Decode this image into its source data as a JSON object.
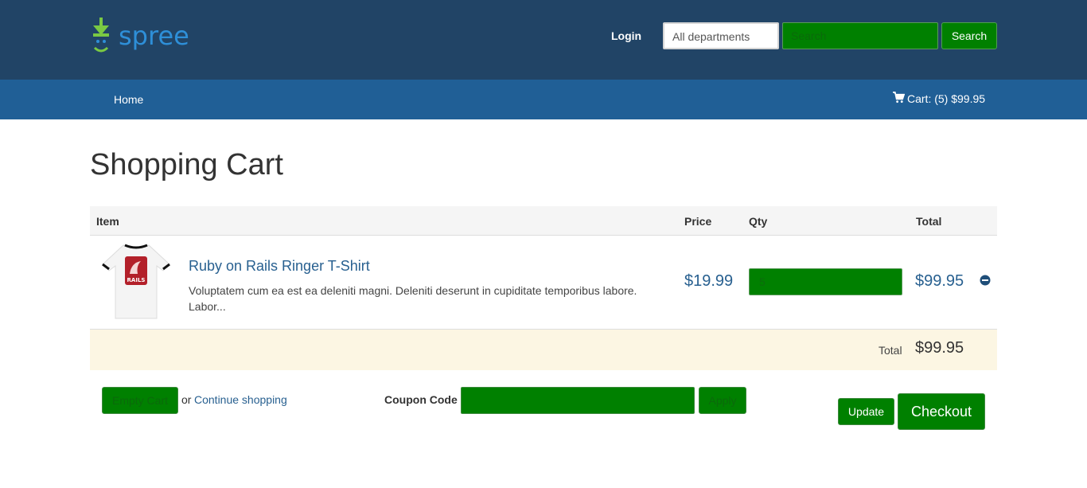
{
  "header": {
    "logo_text": "spree",
    "login_label": "Login",
    "department_select_value": "All departments",
    "search_placeholder": "Search",
    "search_button_label": "Search"
  },
  "nav": {
    "home_label": "Home",
    "cart_label": "Cart: (5) $99.95"
  },
  "page": {
    "title": "Shopping Cart"
  },
  "table": {
    "headers": {
      "item": "Item",
      "price": "Price",
      "qty": "Qty",
      "total": "Total"
    },
    "rows": [
      {
        "name": "Ruby on Rails Ringer T-Shirt",
        "description": "Voluptatem cum ea est ea deleniti magni. Deleniti deserunt in cupiditate temporibus labore. Labor...",
        "price": "$19.99",
        "qty": "5",
        "total": "$99.95",
        "image_label": "RAILS"
      }
    ],
    "total_label": "Total",
    "total_value": "$99.95"
  },
  "actions": {
    "empty_cart_label": "Empty Cart",
    "or_text": "or",
    "continue_shopping_label": "Continue shopping",
    "coupon_label": "Coupon Code",
    "coupon_value": "",
    "apply_label": "Apply",
    "update_label": "Update",
    "checkout_label": "Checkout"
  },
  "colors": {
    "header_bg": "#214466",
    "nav_bg": "#205f96",
    "button_green": "#008000",
    "link_blue": "#286090",
    "total_row_bg": "#fcf6e3"
  },
  "icons": {
    "logo": "spree-logo-icon",
    "cart": "shopping-cart-icon",
    "remove": "minus-circle-icon"
  }
}
